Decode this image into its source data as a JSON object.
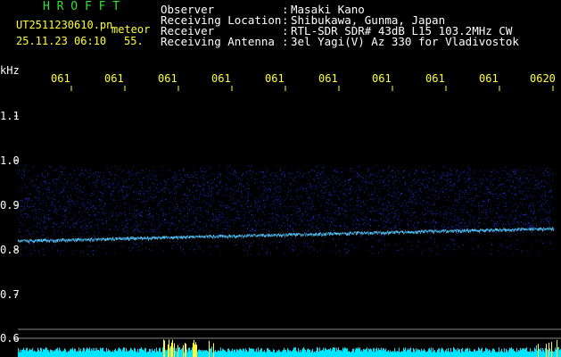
{
  "header": {
    "brand": "H R O F F T",
    "filename": "UT2511230610.pn",
    "meteor_label": "meteor",
    "datetime": "25.11.23 06:10",
    "count": "55."
  },
  "station": {
    "rows": [
      {
        "label": "Observer",
        "sep": ":",
        "value": "Masaki Kano"
      },
      {
        "label": "Receiving Location",
        "sep": ":",
        "value": "Shibukawa, Gunma, Japan"
      },
      {
        "label": "Receiver",
        "sep": ":",
        "value": "RTL-SDR SDR# 43dB L15 103.2MHz CW"
      },
      {
        "label": "Receiving Antenna",
        "sep": ":",
        "value": "3el Yagi(V) Az 330 for Vladivostok"
      }
    ]
  },
  "axis": {
    "unit": "kHz",
    "time_ticks": [
      "061",
      "061",
      "061",
      "061",
      "061",
      "061",
      "061",
      "061",
      "061",
      "0620"
    ],
    "freq_ticks": [
      "1.1",
      "1.0",
      "0.9",
      "0.8",
      "0.7",
      "0.6"
    ]
  },
  "colors": {
    "background": "#000000",
    "brand": "#35e035",
    "label_text": "#ffffff",
    "tick_text": "#ffff33",
    "noise_blue": "#1f3cff",
    "trace": "#55c8ff",
    "power_bar": "#00e5ff"
  }
}
